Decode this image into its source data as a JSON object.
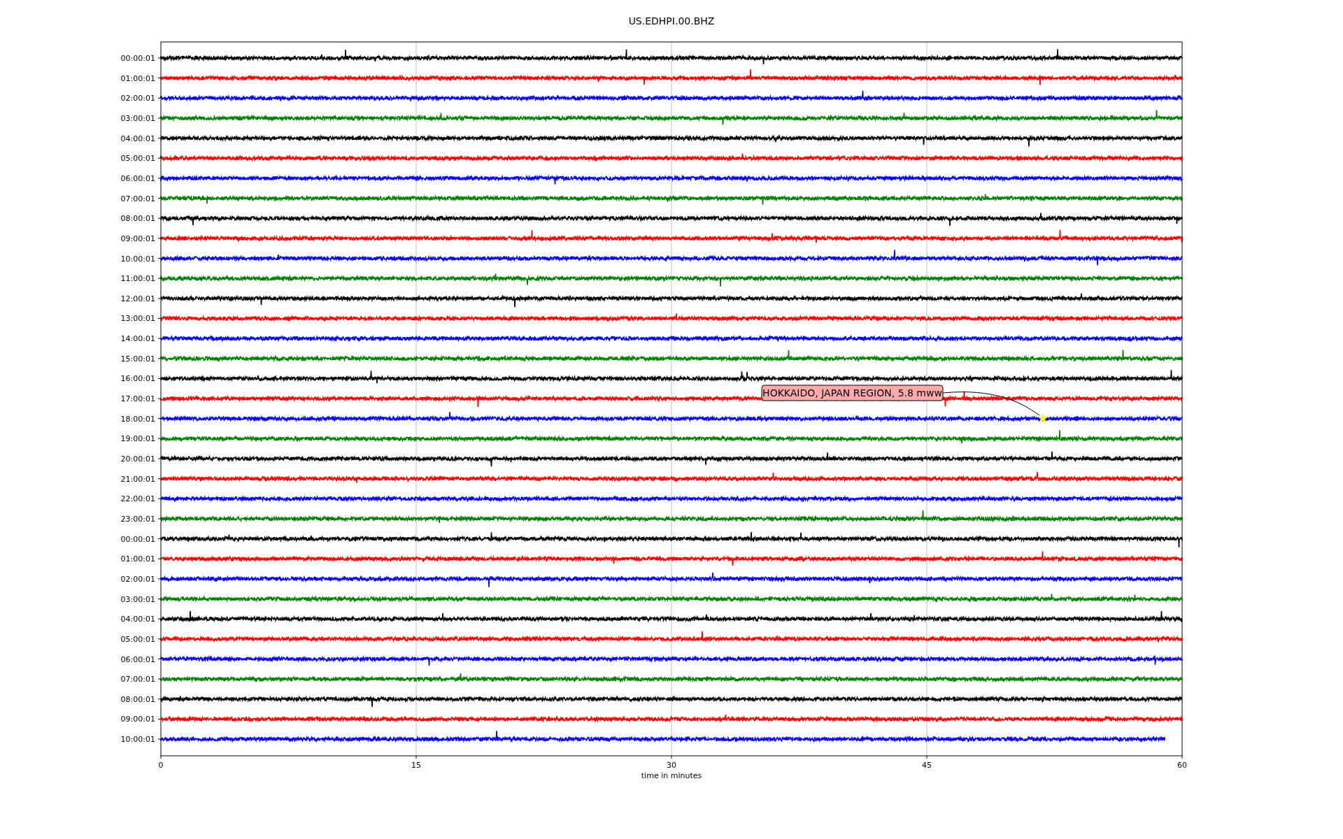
{
  "title": "US.EDHPI.00.BHZ",
  "xlabel": "time in minutes",
  "xticks": [
    {
      "label": "0"
    },
    {
      "label": "15"
    },
    {
      "label": "30"
    },
    {
      "label": "45"
    },
    {
      "label": "60"
    }
  ],
  "rows": [
    {
      "label": "00:00:01",
      "color": "#000000"
    },
    {
      "label": "01:00:01",
      "color": "#ff0000"
    },
    {
      "label": "02:00:01",
      "color": "#0000ff"
    },
    {
      "label": "03:00:01",
      "color": "#008000"
    },
    {
      "label": "04:00:01",
      "color": "#000000"
    },
    {
      "label": "05:00:01",
      "color": "#ff0000"
    },
    {
      "label": "06:00:01",
      "color": "#0000ff"
    },
    {
      "label": "07:00:01",
      "color": "#008000"
    },
    {
      "label": "08:00:01",
      "color": "#000000"
    },
    {
      "label": "09:00:01",
      "color": "#ff0000"
    },
    {
      "label": "10:00:01",
      "color": "#0000ff"
    },
    {
      "label": "11:00:01",
      "color": "#008000"
    },
    {
      "label": "12:00:01",
      "color": "#000000"
    },
    {
      "label": "13:00:01",
      "color": "#ff0000"
    },
    {
      "label": "14:00:01",
      "color": "#0000ff"
    },
    {
      "label": "15:00:01",
      "color": "#008000"
    },
    {
      "label": "16:00:01",
      "color": "#000000"
    },
    {
      "label": "17:00:01",
      "color": "#ff0000"
    },
    {
      "label": "18:00:01",
      "color": "#0000ff"
    },
    {
      "label": "19:00:01",
      "color": "#008000"
    },
    {
      "label": "20:00:01",
      "color": "#000000"
    },
    {
      "label": "21:00:01",
      "color": "#ff0000"
    },
    {
      "label": "22:00:01",
      "color": "#0000ff"
    },
    {
      "label": "23:00:01",
      "color": "#008000"
    },
    {
      "label": "00:00:01",
      "color": "#000000"
    },
    {
      "label": "01:00:01",
      "color": "#ff0000"
    },
    {
      "label": "02:00:01",
      "color": "#0000ff"
    },
    {
      "label": "03:00:01",
      "color": "#008000"
    },
    {
      "label": "04:00:01",
      "color": "#000000"
    },
    {
      "label": "05:00:01",
      "color": "#ff0000"
    },
    {
      "label": "06:00:01",
      "color": "#0000ff"
    },
    {
      "label": "07:00:01",
      "color": "#008000"
    },
    {
      "label": "08:00:01",
      "color": "#000000"
    },
    {
      "label": "09:00:01",
      "color": "#ff0000"
    },
    {
      "label": "10:00:01",
      "color": "#0000ff",
      "partial": true
    }
  ],
  "annotation": {
    "text": "HOKKAIDO, JAPAN REGION, 5.8 mww"
  }
}
